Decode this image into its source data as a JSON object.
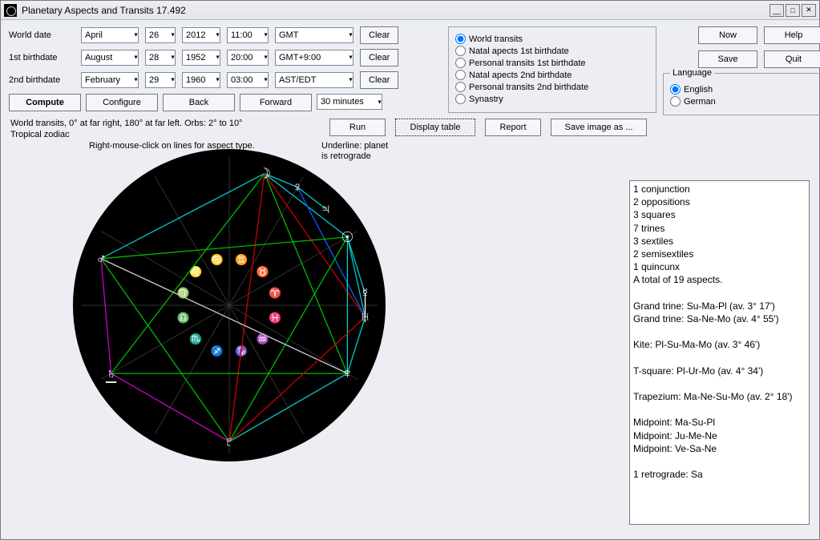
{
  "window": {
    "title": "Planetary Aspects and Transits 17.492"
  },
  "labels": {
    "world_date": "World date",
    "birth1": "1st birthdate",
    "birth2": "2nd birthdate"
  },
  "world_date": {
    "month": "April",
    "day": "26",
    "year": "2012",
    "time": "11:00",
    "tz": "GMT"
  },
  "birth1": {
    "month": "August",
    "day": "28",
    "year": "1952",
    "time": "20:00",
    "tz": "GMT+9:00"
  },
  "birth2": {
    "month": "February",
    "day": "29",
    "year": "1960",
    "time": "03:00",
    "tz": "AST/EDT"
  },
  "buttons": {
    "clear": "Clear",
    "compute": "Compute",
    "configure": "Configure",
    "back": "Back",
    "forward": "Forward",
    "step": "30 minutes",
    "now": "Now",
    "help": "Help",
    "save": "Save",
    "quit": "Quit",
    "run": "Run",
    "display_table": "Display table",
    "report": "Report",
    "save_image": "Save image as ..."
  },
  "mode": {
    "world_transits": "World transits",
    "natal1": "Natal apects 1st birthdate",
    "personal1": "Personal transits 1st birthdate",
    "natal2": "Natal apects 2nd birthdate",
    "personal2": "Personal transits 2nd birthdate",
    "synastry": "Synastry"
  },
  "language": {
    "legend": "Language",
    "english": "English",
    "german": "German"
  },
  "status": {
    "line1": "World transits, 0° at far right, 180° at far left.  Orbs: 2° to 10°",
    "line2": "Tropical zodiac"
  },
  "hints": {
    "left": "Right-mouse-click\non lines for\naspect type.",
    "right": "Underline: planet\nis retrograde"
  },
  "results_text": "1 conjunction\n2 oppositions\n3 squares\n7 trines\n3 sextiles\n2 semisextiles\n1 quincunx\nA total of 19 aspects.\n\nGrand trine: Su-Ma-Pl (av. 3° 17')\nGrand trine: Sa-Ne-Mo (av. 4° 55')\n\nKite: Pl-Su-Ma-Mo (av. 3° 46')\n\nT-square: Pl-Ur-Mo (av. 4° 34')\n\nTrapezium: Ma-Ne-Su-Mo (av. 2° 18')\n\nMidpoint: Ma-Su-Pl\nMidpoint: Ju-Me-Ne\nMidpoint: Ve-Sa-Ne\n\n1 retrograde: Sa",
  "chart_data": {
    "type": "aspect-wheel",
    "planets": [
      {
        "name": "Moon",
        "glyph": "☽",
        "angle": 75
      },
      {
        "name": "Venus",
        "glyph": "♀",
        "angle": 60
      },
      {
        "name": "Jupiter",
        "glyph": "♃",
        "angle": 45
      },
      {
        "name": "Sun",
        "glyph": "☉",
        "angle": 30
      },
      {
        "name": "Mercury",
        "glyph": "☿",
        "angle": 5
      },
      {
        "name": "Uranus",
        "glyph": "♅",
        "angle": -5
      },
      {
        "name": "Neptune",
        "glyph": "♆",
        "angle": -30
      },
      {
        "name": "Pluto",
        "glyph": "♇",
        "angle": -90
      },
      {
        "name": "Saturn",
        "glyph": "♄",
        "angle": -150,
        "retrograde": true
      },
      {
        "name": "Mars",
        "glyph": "♂",
        "angle": 160
      }
    ],
    "aspects": [
      {
        "a": "Moon",
        "b": "Mars",
        "color": "#00cccc"
      },
      {
        "a": "Moon",
        "b": "Venus",
        "color": "#00cccc"
      },
      {
        "a": "Moon",
        "b": "Sun",
        "color": "#00cccc"
      },
      {
        "a": "Moon",
        "b": "Neptune",
        "color": "#00bb00"
      },
      {
        "a": "Moon",
        "b": "Saturn",
        "color": "#00bb00"
      },
      {
        "a": "Moon",
        "b": "Pluto",
        "color": "#cc0000"
      },
      {
        "a": "Moon",
        "b": "Uranus",
        "color": "#cc0000"
      },
      {
        "a": "Venus",
        "b": "Jupiter",
        "color": "#00cccc"
      },
      {
        "a": "Venus",
        "b": "Uranus",
        "color": "#0066ff"
      },
      {
        "a": "Sun",
        "b": "Mars",
        "color": "#00bb00"
      },
      {
        "a": "Sun",
        "b": "Neptune",
        "color": "#00cccc"
      },
      {
        "a": "Sun",
        "b": "Pluto",
        "color": "#00bb00"
      },
      {
        "a": "Sun",
        "b": "Mercury",
        "color": "#00cccc"
      },
      {
        "a": "Sun",
        "b": "Uranus",
        "color": "#00cccc"
      },
      {
        "a": "Mars",
        "b": "Neptune",
        "color": "#cccccc"
      },
      {
        "a": "Mars",
        "b": "Pluto",
        "color": "#00bb00"
      },
      {
        "a": "Mars",
        "b": "Saturn",
        "color": "#cc00cc"
      },
      {
        "a": "Saturn",
        "b": "Neptune",
        "color": "#00bb00"
      },
      {
        "a": "Saturn",
        "b": "Pluto",
        "color": "#cc00cc"
      },
      {
        "a": "Neptune",
        "b": "Pluto",
        "color": "#00cccc"
      },
      {
        "a": "Mercury",
        "b": "Uranus",
        "color": "#ffffff"
      },
      {
        "a": "Uranus",
        "b": "Pluto",
        "color": "#cc0000"
      },
      {
        "a": "Uranus",
        "b": "Neptune",
        "color": "#00cccc"
      }
    ],
    "zodiac_glyphs": [
      "♈",
      "♉",
      "♊",
      "♋",
      "♌",
      "♍",
      "♎",
      "♏",
      "♐",
      "♑",
      "♒",
      "♓"
    ]
  }
}
